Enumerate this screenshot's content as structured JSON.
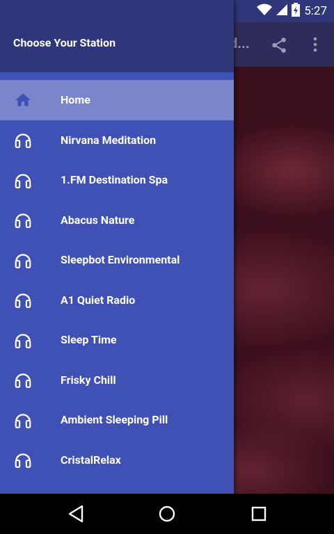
{
  "status_bar": {
    "time": "5:27"
  },
  "app_bar": {
    "title_truncated": "d..."
  },
  "drawer": {
    "title": "Choose Your Station",
    "items": [
      {
        "label": "Home",
        "icon": "home-icon",
        "active": true
      },
      {
        "label": "Nirvana Meditation",
        "icon": "headphones-icon"
      },
      {
        "label": "1.FM Destination Spa",
        "icon": "headphones-icon"
      },
      {
        "label": "Abacus Nature",
        "icon": "headphones-icon"
      },
      {
        "label": "Sleepbot Environmental",
        "icon": "headphones-icon"
      },
      {
        "label": "A1 Quiet Radio",
        "icon": "headphones-icon"
      },
      {
        "label": "Sleep Time",
        "icon": "headphones-icon"
      },
      {
        "label": "Frisky Chill",
        "icon": "headphones-icon"
      },
      {
        "label": "Ambient Sleeping Pill",
        "icon": "headphones-icon"
      },
      {
        "label": "CristalRelax",
        "icon": "headphones-icon"
      }
    ]
  },
  "colors": {
    "drawer_bg": "#3f51b5",
    "header_bg": "#2f367a",
    "active_bg": "#7986cb"
  }
}
